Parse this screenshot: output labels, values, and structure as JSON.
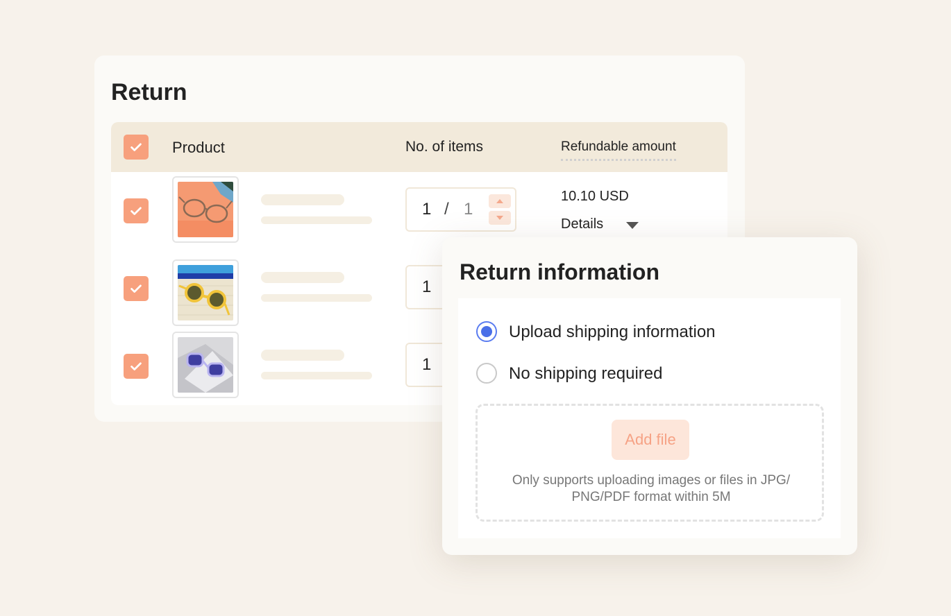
{
  "return_card": {
    "title": "Return",
    "table": {
      "headers": {
        "product": "Product",
        "items": "No. of items",
        "refundable_amount": "Refundable amount"
      },
      "rows": [
        {
          "product_image": "clear-frame-glasses-on-orange",
          "qty_current": "1",
          "qty_sep": "/",
          "qty_total": "1",
          "amount": "10.10 USD",
          "details_label": "Details"
        },
        {
          "product_image": "yellow-round-sunglasses",
          "qty_current": "1"
        },
        {
          "product_image": "purple-lens-sunglasses",
          "qty_current": "1"
        }
      ]
    }
  },
  "info_card": {
    "title": "Return information",
    "options": [
      {
        "label": "Upload shipping information",
        "selected": true
      },
      {
        "label": "No shipping required",
        "selected": false
      }
    ],
    "add_file_label": "Add file",
    "hint": "Only supports uploading images or files in JPG/ PNG/PDF format within 5M"
  },
  "colors": {
    "background": "#f7f2eb",
    "checkbox": "#f7a07d",
    "radio_selected": "#4a6fe8",
    "header_bg": "#f2eadb",
    "add_file_bg": "#fde6da"
  }
}
